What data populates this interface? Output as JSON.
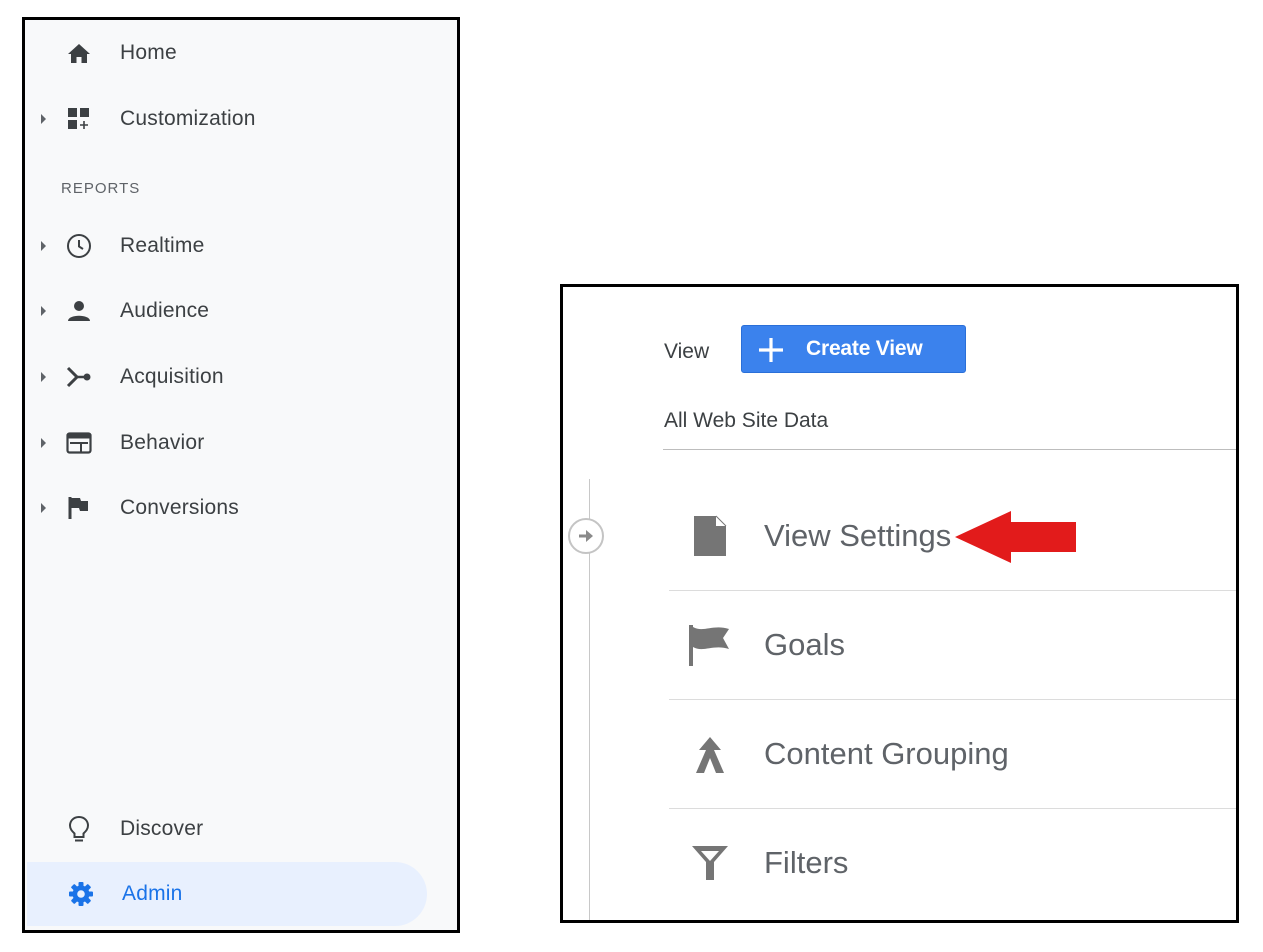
{
  "sidebar": {
    "items_top": [
      {
        "label": "Home",
        "icon": "home-icon",
        "has_caret": false
      },
      {
        "label": "Customization",
        "icon": "dashboard-add-icon",
        "has_caret": true
      }
    ],
    "section_label": "REPORTS",
    "report_items": [
      {
        "label": "Realtime",
        "icon": "clock-icon"
      },
      {
        "label": "Audience",
        "icon": "person-icon"
      },
      {
        "label": "Acquisition",
        "icon": "acquisition-icon"
      },
      {
        "label": "Behavior",
        "icon": "behavior-icon"
      },
      {
        "label": "Conversions",
        "icon": "flag-icon"
      }
    ],
    "discover_label": "Discover",
    "admin_label": "Admin",
    "active_item": "Admin",
    "accent_color": "#1a73e8"
  },
  "admin_view": {
    "view_label": "View",
    "create_view_label": "Create View",
    "view_name": "All Web Site Data",
    "rows": [
      {
        "label": "View Settings",
        "icon": "document-icon"
      },
      {
        "label": "Goals",
        "icon": "flag-icon"
      },
      {
        "label": "Content Grouping",
        "icon": "content-grouping-icon"
      },
      {
        "label": "Filters",
        "icon": "filter-icon"
      }
    ],
    "button_color": "#3b82ed",
    "annotation": {
      "points_to": "View Settings",
      "color": "#e21b1b"
    }
  }
}
